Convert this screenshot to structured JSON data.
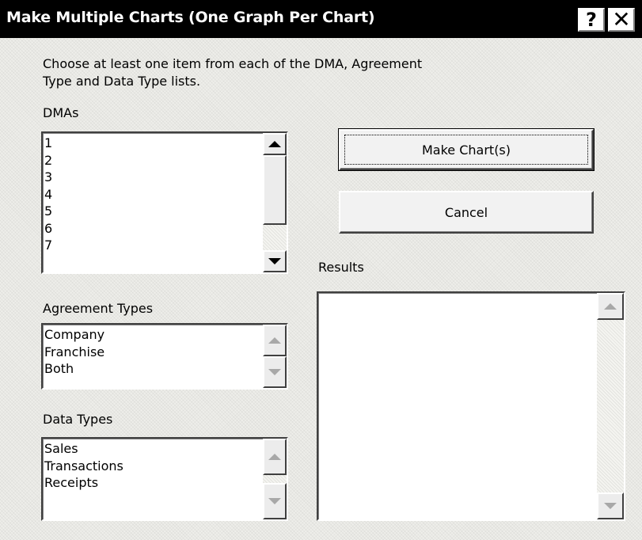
{
  "dialog": {
    "title": "Make Multiple Charts (One Graph Per Chart)",
    "help_label": "?",
    "close_label": "✕",
    "instruction_line1": "Choose at least one item from each of the DMA, Agreement",
    "instruction_line2": "Type and Data Type lists."
  },
  "dmas": {
    "label": "DMAs",
    "items": [
      "1",
      "2",
      "3",
      "4",
      "5",
      "6",
      "7"
    ]
  },
  "agreement_types": {
    "label": "Agreement Types",
    "items": [
      "Company",
      "Franchise",
      "Both"
    ]
  },
  "data_types": {
    "label": "Data Types",
    "items": [
      "Sales",
      "Transactions",
      "Receipts"
    ]
  },
  "buttons": {
    "make_charts": "Make Chart(s)",
    "cancel": "Cancel"
  },
  "results": {
    "label": "Results",
    "items": []
  },
  "icons": {
    "scroll_up": "arrow-up-icon",
    "scroll_down": "arrow-down-icon",
    "help": "question-mark-icon",
    "close": "close-icon"
  },
  "colors": {
    "titlebar_bg": "#000000",
    "titlebar_text": "#ffffff",
    "dialog_bg": "#eeeeea",
    "list_bg": "#ffffff"
  }
}
